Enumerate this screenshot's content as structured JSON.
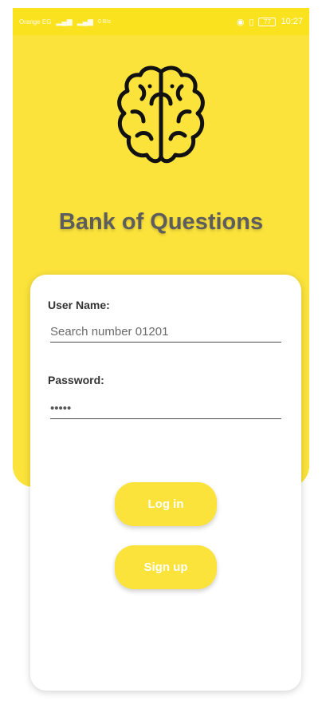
{
  "status_bar": {
    "carrier": "Orange EG",
    "net_speed": "0 B/s",
    "time": "10:27",
    "battery": "77"
  },
  "logo": {
    "icon": "brain-icon"
  },
  "app": {
    "title": "Bank of Questions"
  },
  "form": {
    "username_label": "User Name:",
    "username_placeholder": "Search number 01201",
    "password_label": "Password:",
    "password_value": "12345"
  },
  "actions": {
    "login_label": "Log in",
    "signup_label": "Sign up"
  },
  "colors": {
    "accent": "#fbe33c",
    "title": "#5d5d5d"
  }
}
